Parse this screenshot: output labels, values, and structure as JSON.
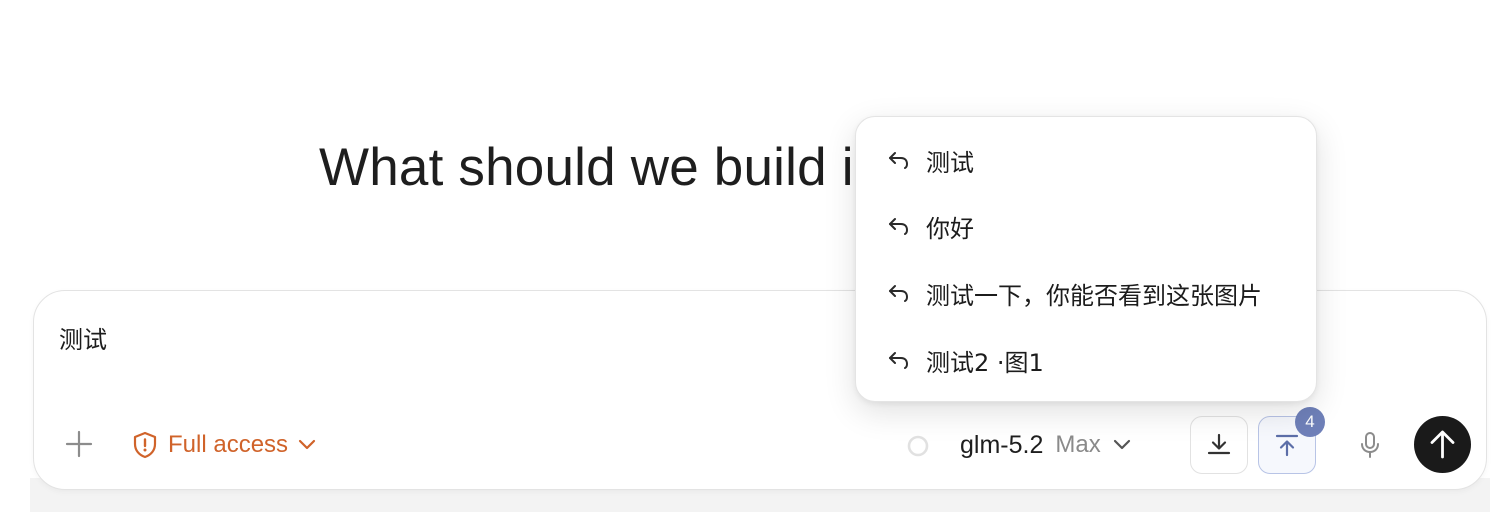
{
  "main": {
    "headline": "What should we build i"
  },
  "composer": {
    "input_value": "测试",
    "access_label": "Full access",
    "model_name": "glm-5.2",
    "model_tier": "Max",
    "upload_badge_count": "4"
  },
  "history_popup": {
    "items": [
      {
        "label": "测试"
      },
      {
        "label": "你好"
      },
      {
        "label": "测试一下，你能否看到这张图片"
      },
      {
        "label": "测试2 ·图1"
      }
    ]
  },
  "colors": {
    "accent_orange": "#d0632a",
    "badge_blue": "#6f80b9",
    "send_button": "#1a1a1a"
  },
  "icons": {
    "plus": "plus-icon",
    "access": "shield-alert-icon",
    "chevron": "chevron-down-icon",
    "status": "circle-outline-icon",
    "download": "download-icon",
    "upload": "upload-icon",
    "mic": "microphone-icon",
    "send": "arrow-up-icon",
    "history_item": "reply-arrow-icon"
  }
}
